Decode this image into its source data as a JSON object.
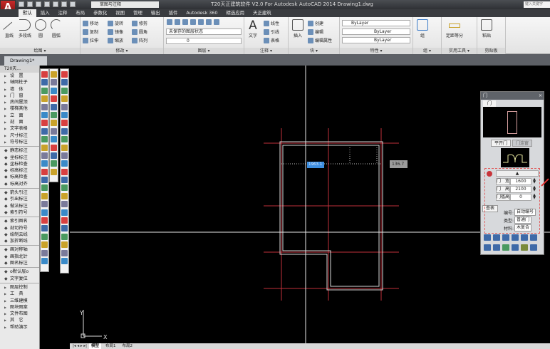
{
  "titlebar": {
    "title": "T20天正建筑软件 V2.0 For Autodesk AutoCAD 2014    Drawing1.dwg",
    "workspace": "草图与注释",
    "search_placeholder": "键入关键字",
    "app_letter": "A"
  },
  "ribbon": {
    "tabs": [
      "默认",
      "插入",
      "注释",
      "布局",
      "参数化",
      "视图",
      "管理",
      "输出",
      "插件",
      "Autodesk 360",
      "精选应用",
      "天正建筑"
    ],
    "draw": {
      "title": "绘图 ▾",
      "line": "直线",
      "polyline": "多段线",
      "circle": "圆",
      "arc": "圆弧"
    },
    "modify": {
      "title": "修改 ▾",
      "move": "移动",
      "rotate": "旋转",
      "trim": "修剪",
      "copy": "复制",
      "mirror": "镜像",
      "fillet": "圆角",
      "stretch": "拉伸",
      "scale": "缩放",
      "array": "阵列"
    },
    "layers": {
      "title": "图层 ▾",
      "state": "未保存的图层状态",
      "current": "0"
    },
    "annotation": {
      "title": "注释 ▾",
      "text": "文字",
      "linear": "线性",
      "leader": "引线",
      "table": "表格"
    },
    "block": {
      "title": "块 ▾",
      "insert": "插入",
      "create": "创建",
      "edit": "编辑",
      "edit_attr": "编辑属性"
    },
    "properties": {
      "title": "特性 ▾",
      "color": "ByLayer",
      "linetype": "ByLayer",
      "lineweight": "ByLayer"
    },
    "groups": {
      "title": "组 ▾",
      "group": "组"
    },
    "utilities": {
      "title": "实用工具 ▾",
      "measure": "定距等分"
    },
    "clipboard": {
      "title": "剪贴板",
      "paste": "粘贴"
    }
  },
  "doc_tab": "Drawing1*",
  "left_menu": {
    "header": "T20天...",
    "top": [
      "设　置",
      "轴网柱子",
      "墙　体",
      "门　窗",
      "房间屋顶",
      "楼梯其他",
      "立　面",
      "剖　面",
      "文字表格",
      "尺寸标注"
    ],
    "expanded": "符号标注",
    "group1": [
      "静态标注",
      "坐标标注",
      "坐标检查",
      "标高标注",
      "标高检查",
      "标高对齐"
    ],
    "group2": [
      "箭头引注",
      "引出标注",
      "做法标注",
      "索引符号"
    ],
    "group3": [
      "索引图名",
      "剖切符号",
      "绘制云线",
      "加折断线"
    ],
    "group4": [
      "画对称轴",
      "画指北针",
      "图名标注"
    ],
    "group5": [
      "o默认层o",
      "文字复位"
    ],
    "bottom": [
      "图层控制",
      "工　具",
      "三维建模",
      "图块图案",
      "文件布图",
      "其　它",
      "帮助演示"
    ]
  },
  "canvas": {
    "dim_input_1": "1963.1",
    "dim_input_2": "136.7",
    "ucs_x": "X",
    "ucs_y": "Y"
  },
  "layout_tabs": [
    "模型",
    "布局1",
    "布局2"
  ],
  "layout_nav": "|◂ ◂ ▸ ▸|",
  "door_panel": {
    "title": "门",
    "close": "×",
    "tab": "门",
    "subtabs": [
      "平开门",
      "门连窗"
    ],
    "fields": [
      {
        "label": "门　宽",
        "value": "1600"
      },
      {
        "label": "门　高",
        "value": "2100"
      },
      {
        "label": "门槛高",
        "value": "0"
      }
    ],
    "lookup": "查表",
    "selects": [
      {
        "label": "编号:",
        "value": "自动编号"
      },
      {
        "label": "类型:",
        "value": "普通门"
      },
      {
        "label": "材料:",
        "value": "木复合"
      }
    ]
  },
  "colors": {
    "canvas": "#000000",
    "grid_red": "#c0303a",
    "wall": "#d8d8d8",
    "highlight": "#3d8ee0",
    "arrow": "#e03030"
  }
}
